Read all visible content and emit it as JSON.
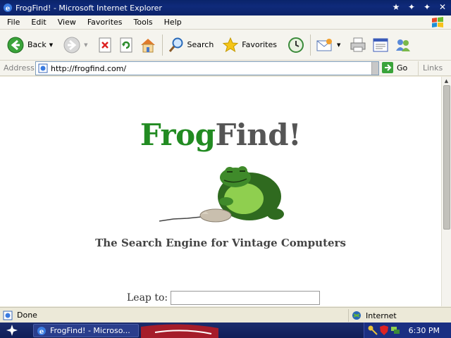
{
  "window": {
    "title": "FrogFind! - Microsoft Internet Explorer"
  },
  "menu": {
    "items": [
      "File",
      "Edit",
      "View",
      "Favorites",
      "Tools",
      "Help"
    ]
  },
  "toolbar": {
    "back_label": "Back",
    "search_label": "Search",
    "favorites_label": "Favorites"
  },
  "address": {
    "label": "Address",
    "url": "http://frogfind.com/",
    "go_label": "Go",
    "links_label": "Links"
  },
  "page": {
    "logo_frog": "Frog",
    "logo_find": "Find!",
    "tagline": "The Search Engine for Vintage Computers",
    "leap_label": "Leap to:",
    "leap_value": ""
  },
  "status": {
    "text": "Done",
    "zone": "Internet"
  },
  "taskbar": {
    "task_label": "FrogFind! - Microso...",
    "clock": "6:30 PM"
  },
  "colors": {
    "title_bar": "#0a246a",
    "logo_frog": "#228b22",
    "logo_find": "#555555"
  }
}
